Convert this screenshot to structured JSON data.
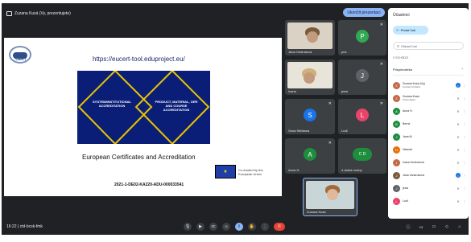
{
  "topbar": {
    "presenter_label": "Zuzana Kusá (Vy, prezentujete)",
    "stop_label": "Ukončit prezentaci"
  },
  "slide": {
    "url": "https://eucert-tool.eduproject.eu/",
    "logo_text": "CERT",
    "left_box": "SYSTEM/INSTITUTIONAL ACCREDITATION",
    "right_box": "PRODUCT, MATERIAL, OER AND COURSE ACCREDITATION",
    "title": "European Certificates and Accreditation",
    "eu_text": "Co-funded by the European Union",
    "project_number": "2021-1-DE02-KA220-ADU-000033541"
  },
  "tiles": [
    {
      "name": "Jana Ondrušová",
      "kind": "photo"
    },
    {
      "name": "pns",
      "kind": "avatar",
      "letter": "P",
      "color": "#33a852"
    },
    {
      "name": "Ivana",
      "kind": "photo"
    },
    {
      "name": "jessi",
      "kind": "avatar",
      "letter": "J",
      "color": "#5f6368"
    },
    {
      "name": "Sona Stefanca",
      "kind": "avatar",
      "letter": "S",
      "color": "#1a73e8"
    },
    {
      "name": "Ludi",
      "kind": "avatar",
      "letter": "L",
      "color": "#e8446a"
    },
    {
      "name": "Anna H.",
      "kind": "avatar",
      "letter": "A",
      "color": "#1e8e3e"
    },
    {
      "name": "4 dalsie osoby",
      "kind": "group",
      "letters": "C D"
    },
    {
      "name": "Zuzana Kusá",
      "kind": "self"
    }
  ],
  "bottombar": {
    "time": "16:22",
    "meeting_code": "ctd-bcsk-fmk",
    "participant_count": "13"
  },
  "panel": {
    "title": "Účastníci",
    "add_label": "Pridať ľudí",
    "search_placeholder": "Hľadať ľudí",
    "section_label": "V SCHÔDZI",
    "subhead": "Prispievatelia",
    "subhead_count": "13",
    "people": [
      {
        "name": "Zuzana Kusá (Vy)",
        "sub": "Hostiteľ schôdze",
        "letter": "Z",
        "color": "#c26a4a",
        "status": "blue"
      },
      {
        "name": "Zuzana Kusá",
        "sub": "Prezentácia",
        "letter": "Z",
        "color": "#c26a4a",
        "status": "mute"
      },
      {
        "name": "Anna H.",
        "sub": "",
        "letter": "A",
        "color": "#1e8e3e",
        "status": "mute"
      },
      {
        "name": "Bernd",
        "sub": "",
        "letter": "B",
        "color": "#1e8e3e",
        "status": "mute"
      },
      {
        "name": "Jana M.",
        "sub": "",
        "letter": "J",
        "color": "#1e8e3e",
        "status": "mute"
      },
      {
        "name": "Hannah",
        "sub": "",
        "letter": "H",
        "color": "#e8710a",
        "status": "mute"
      },
      {
        "name": "Ivana Ondrušová",
        "sub": "",
        "letter": "I",
        "color": "#c26a4a",
        "status": "mute"
      },
      {
        "name": "Jana Vandruková",
        "sub": "",
        "letter": "J",
        "color": "#7a5a3c",
        "status": "blue"
      },
      {
        "name": "jessi",
        "sub": "",
        "letter": "J",
        "color": "#5f6368",
        "status": "mute"
      },
      {
        "name": "Ludi",
        "sub": "",
        "letter": "L",
        "color": "#e8446a",
        "status": "mute"
      }
    ]
  }
}
